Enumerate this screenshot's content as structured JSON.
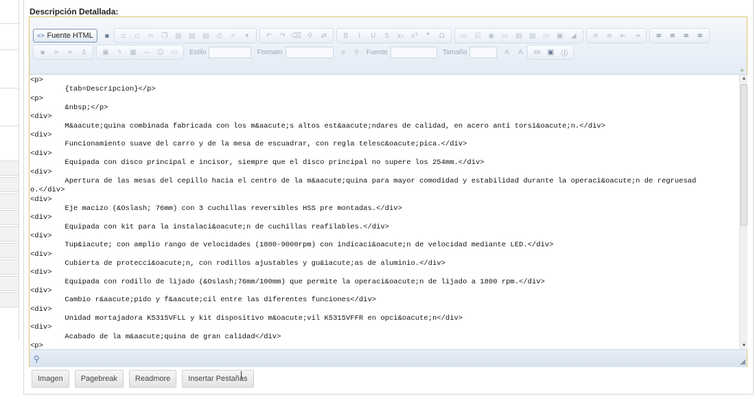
{
  "section_title": "Descripción Detallada:",
  "toolbar": {
    "source_label": "Fuente HTML",
    "style_label": "Estilo",
    "format_label": "Formato",
    "font_label": "Fuente",
    "size_label": "Tamaño"
  },
  "icons": {
    "source": "source-html-icon",
    "zoom": "magnifier-icon",
    "resize": "resize-grip-icon"
  },
  "colors": {
    "editor_border": "#e2c36e",
    "toolbar_bg": "#e3ebf5",
    "status_bg": "#d8e3f0"
  },
  "code_lines": [
    "<p>",
    "        {tab=Descripcion}</p>",
    "<p>",
    "        &nbsp;</p>",
    "<div>",
    "        M&aacute;quina combinada fabricada con los m&aacute;s altos est&aacute;ndares de calidad, en acero anti torsi&oacute;n.</div>",
    "<div>",
    "        Funcionamiento suave del carro y de la mesa de escuadrar, con regla telesc&oacute;pica.</div>",
    "<div>",
    "        Equipada con disco principal e incisor, siempre que el disco principal no supere los 254mm.</div>",
    "<div>",
    "        Apertura de las mesas del cepillo hacia el centro de la m&aacute;quina para mayor comodidad y estabilidad durante la operaci&oacute;n de regruesad",
    "o.</div>",
    "<div>",
    "        Eje macizo (&Oslash; 76mm) con 3 cuchillas reversibles HSS pre montadas.</div>",
    "<div>",
    "        Equipada con kit para la instalaci&oacute;n de cuchillas reafilables.</div>",
    "<div>",
    "        Tup&iacute; con amplio rango de velocidades (1800-9000rpm) con indicaci&oacute;n de velocidad mediante LED.</div>",
    "<div>",
    "        Cubierta de protecci&oacute;n, con rodillos ajustables y gu&iacute;as de aluminio.</div>",
    "<div>",
    "        Equipada con rodillo de lijado (&Oslash;76mm/100mm) que permite la operaci&oacute;n de lijado a 1800 rpm.</div>",
    "<div>",
    "        Cambio r&aacute;pido y f&aacute;cil entre las diferentes funciones</div>",
    "<div>",
    "        Unidad mortajadora K5315VFLL y kit dispositivo m&oacute;vil K5315VFFR en opci&oacute;n</div>",
    "<div>",
    "        Acabado de la m&aacute;quina de gran calidad</div>",
    "<p>"
  ],
  "buttons": {
    "image": "Imagen",
    "pagebreak": "Pagebreak",
    "readmore": "Readmore",
    "insert_tabs": "Insertar Pestañas"
  }
}
